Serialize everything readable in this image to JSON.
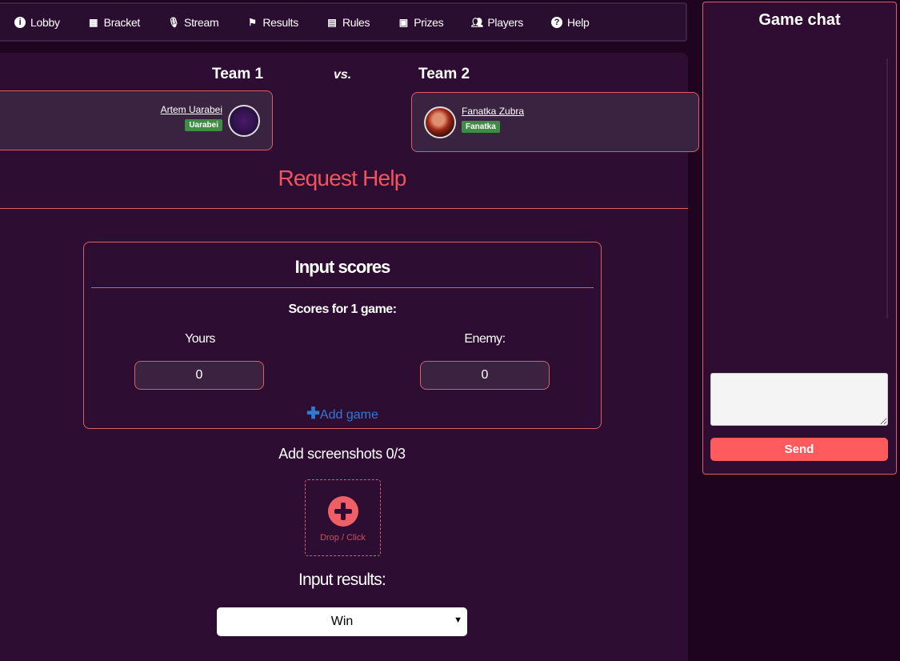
{
  "nav": {
    "items": [
      {
        "label": "Lobby",
        "icon": "info-icon"
      },
      {
        "label": "Bracket",
        "icon": "table-icon"
      },
      {
        "label": "Stream",
        "icon": "microphone-icon"
      },
      {
        "label": "Results",
        "icon": "flag-icon"
      },
      {
        "label": "Rules",
        "icon": "book-icon"
      },
      {
        "label": "Prizes",
        "icon": "gift-icon"
      },
      {
        "label": "Players",
        "icon": "users-icon"
      },
      {
        "label": "Help",
        "icon": "question-icon"
      }
    ]
  },
  "match": {
    "team1": {
      "title": "Team 1",
      "player": "Artem Uarabei",
      "tag": "Uarabei"
    },
    "vs": "vs.",
    "team2": {
      "title": "Team 2",
      "player": "Fanatka Zubra",
      "tag": "Fanatka"
    }
  },
  "request_help": "Request Help",
  "scores": {
    "title": "Input scores",
    "subtitle": "Scores for 1 game:",
    "yours_label": "Yours",
    "enemy_label": "Enemy:",
    "yours_value": "0",
    "enemy_value": "0",
    "add_game": "Add game"
  },
  "screenshots": {
    "label": "Add screenshots 0/3",
    "drop": "Drop / Click"
  },
  "results": {
    "label": "Input results:",
    "selected": "Win"
  },
  "chat": {
    "title": "Game chat",
    "message": "",
    "send": "Send"
  },
  "colors": {
    "accent": "#f2545b",
    "panel": "#2e0d33",
    "tag": "#3f8c45",
    "link": "#2f7ad8"
  }
}
